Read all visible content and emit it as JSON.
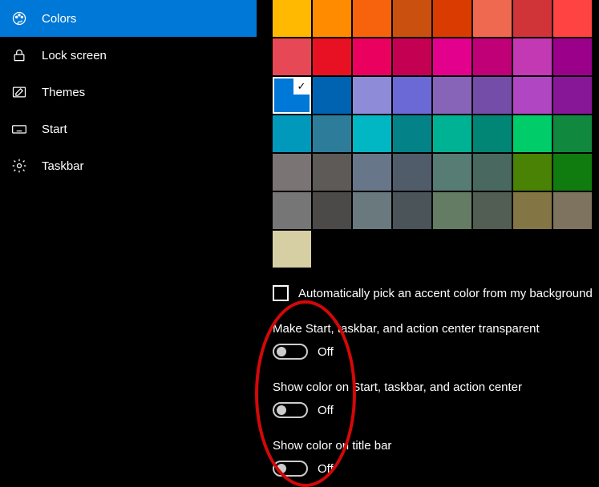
{
  "sidebar": {
    "items": [
      {
        "label": "Colors",
        "icon": "palette-icon",
        "selected": true
      },
      {
        "label": "Lock screen",
        "icon": "lock-icon",
        "selected": false
      },
      {
        "label": "Themes",
        "icon": "pencil-icon",
        "selected": false
      },
      {
        "label": "Start",
        "icon": "keyboard-icon",
        "selected": false
      },
      {
        "label": "Taskbar",
        "icon": "gear-icon",
        "selected": false
      }
    ]
  },
  "palette": {
    "selected_row": 2,
    "selected_col": 0,
    "rows": [
      [
        "#ffb900",
        "#ff8c00",
        "#f7630c",
        "#ca5010",
        "#da3b01",
        "#ef6950",
        "#d13438",
        "#ff4343"
      ],
      [
        "#e74856",
        "#e81123",
        "#ea005e",
        "#c30052",
        "#e3008c",
        "#bf0077",
        "#c239b3",
        "#9a0089"
      ],
      [
        "#0078d7",
        "#0063b1",
        "#8e8cd8",
        "#6b69d6",
        "#8764b8",
        "#744da9",
        "#b146c2",
        "#881798"
      ],
      [
        "#0099bc",
        "#2d7d9a",
        "#00b7c3",
        "#038387",
        "#00b294",
        "#018574",
        "#00cc6a",
        "#10893e"
      ],
      [
        "#7a7574",
        "#5d5a58",
        "#68768a",
        "#515c6b",
        "#567c73",
        "#486860",
        "#498205",
        "#107c10"
      ],
      [
        "#767676",
        "#4c4a48",
        "#69797e",
        "#4a5459",
        "#647c64",
        "#525e54",
        "#847545",
        "#7e735f"
      ]
    ],
    "extra_row": [
      "#d6cfa4"
    ]
  },
  "auto_accent": {
    "checked": false,
    "label": "Automatically pick an accent color from my background"
  },
  "options": [
    {
      "label": "Make Start, taskbar, and action center transparent",
      "on": false,
      "state": "Off"
    },
    {
      "label": "Show color on Start, taskbar, and action center",
      "on": false,
      "state": "Off"
    },
    {
      "label": "Show color on title bar",
      "on": false,
      "state": "Off"
    }
  ]
}
